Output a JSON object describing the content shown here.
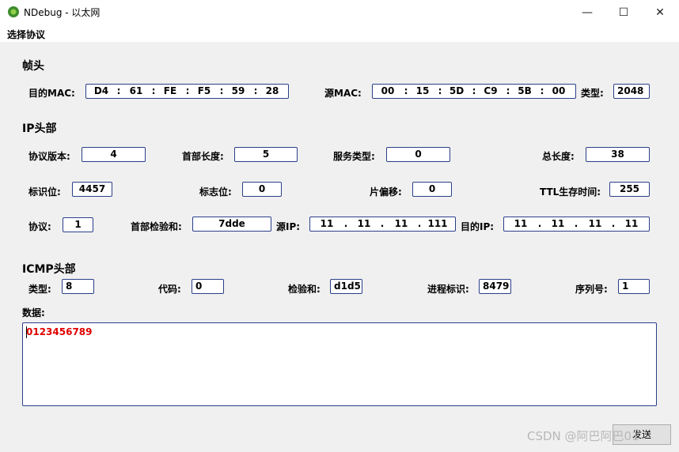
{
  "window": {
    "title": "NDebug - 以太网",
    "minimize": "—",
    "maximize": "☐",
    "close": "✕"
  },
  "menu": {
    "item": "选择协议"
  },
  "frame": {
    "section": "帧头",
    "dst_mac_label": "目的MAC:",
    "dst_mac": [
      "D4",
      "61",
      "FE",
      "F5",
      "59",
      "28"
    ],
    "src_mac_label": "源MAC:",
    "src_mac": [
      "00",
      "15",
      "5D",
      "C9",
      "5B",
      "00"
    ],
    "type_label": "类型:",
    "type_value": "2048",
    "mac_sep": ":"
  },
  "ip": {
    "section": "IP头部",
    "version_label": "协议版本:",
    "version": "4",
    "ihl_label": "首部长度:",
    "ihl": "5",
    "tos_label": "服务类型:",
    "tos": "0",
    "total_len_label": "总长度:",
    "total_len": "38",
    "id_label": "标识位:",
    "id": "4457",
    "flags_label": "标志位:",
    "flags": "0",
    "offset_label": "片偏移:",
    "offset": "0",
    "ttl_label": "TTL生存时间:",
    "ttl": "255",
    "proto_label": "协议:",
    "proto": "1",
    "checksum_label": "首部检验和:",
    "checksum": "7dde",
    "src_ip_label": "源IP:",
    "src_ip": [
      "11",
      "11",
      "11",
      "111"
    ],
    "dst_ip_label": "目的IP:",
    "dst_ip": [
      "11",
      "11",
      "11",
      "11"
    ],
    "ip_sep": "."
  },
  "icmp": {
    "section": "ICMP头部",
    "type_label": "类型:",
    "type": "8",
    "code_label": "代码:",
    "code": "0",
    "checksum_label": "检验和:",
    "checksum": "d1d5",
    "pid_label": "进程标识:",
    "pid": "8479",
    "seq_label": "序列号:",
    "seq": "1"
  },
  "data": {
    "label": "数据:",
    "value": "0123456789"
  },
  "send_button": "发送",
  "watermark": "CSDN @阿巴阿巴01",
  "colors": {
    "field_border": "#2b3f8a",
    "data_text": "#e00000",
    "client_bg": "#f0f0f0"
  }
}
